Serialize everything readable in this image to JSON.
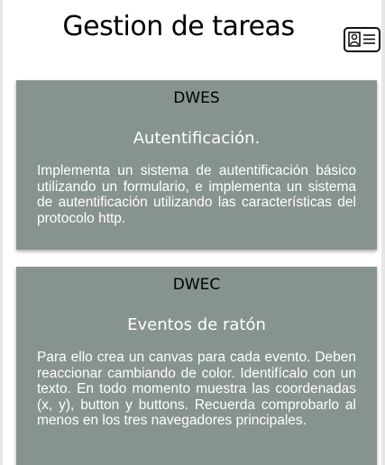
{
  "header": {
    "title": "Gestion de tareas",
    "profile_icon": "contact-card-icon"
  },
  "tasks": [
    {
      "subject": "DWES",
      "title": "Autentificación.",
      "description": "Implementa un sistema de autentificación básico utilizando un formulario, e implementa un sistema de autentificación utilizando las características del protocolo http."
    },
    {
      "subject": "DWEC",
      "title": "Eventos de ratón",
      "description": "Para ello crea un canvas para cada evento. Deben reaccionar cambiando de color. Identifícalo con un texto. En todo momento muestra las coordenadas (x, y), button y buttons. Recuerda comprobarlo al menos en los tres navegadores principales."
    }
  ],
  "colors": {
    "card_background": "#87938f",
    "card_text": "#ffffff",
    "heading_text": "#000000"
  }
}
